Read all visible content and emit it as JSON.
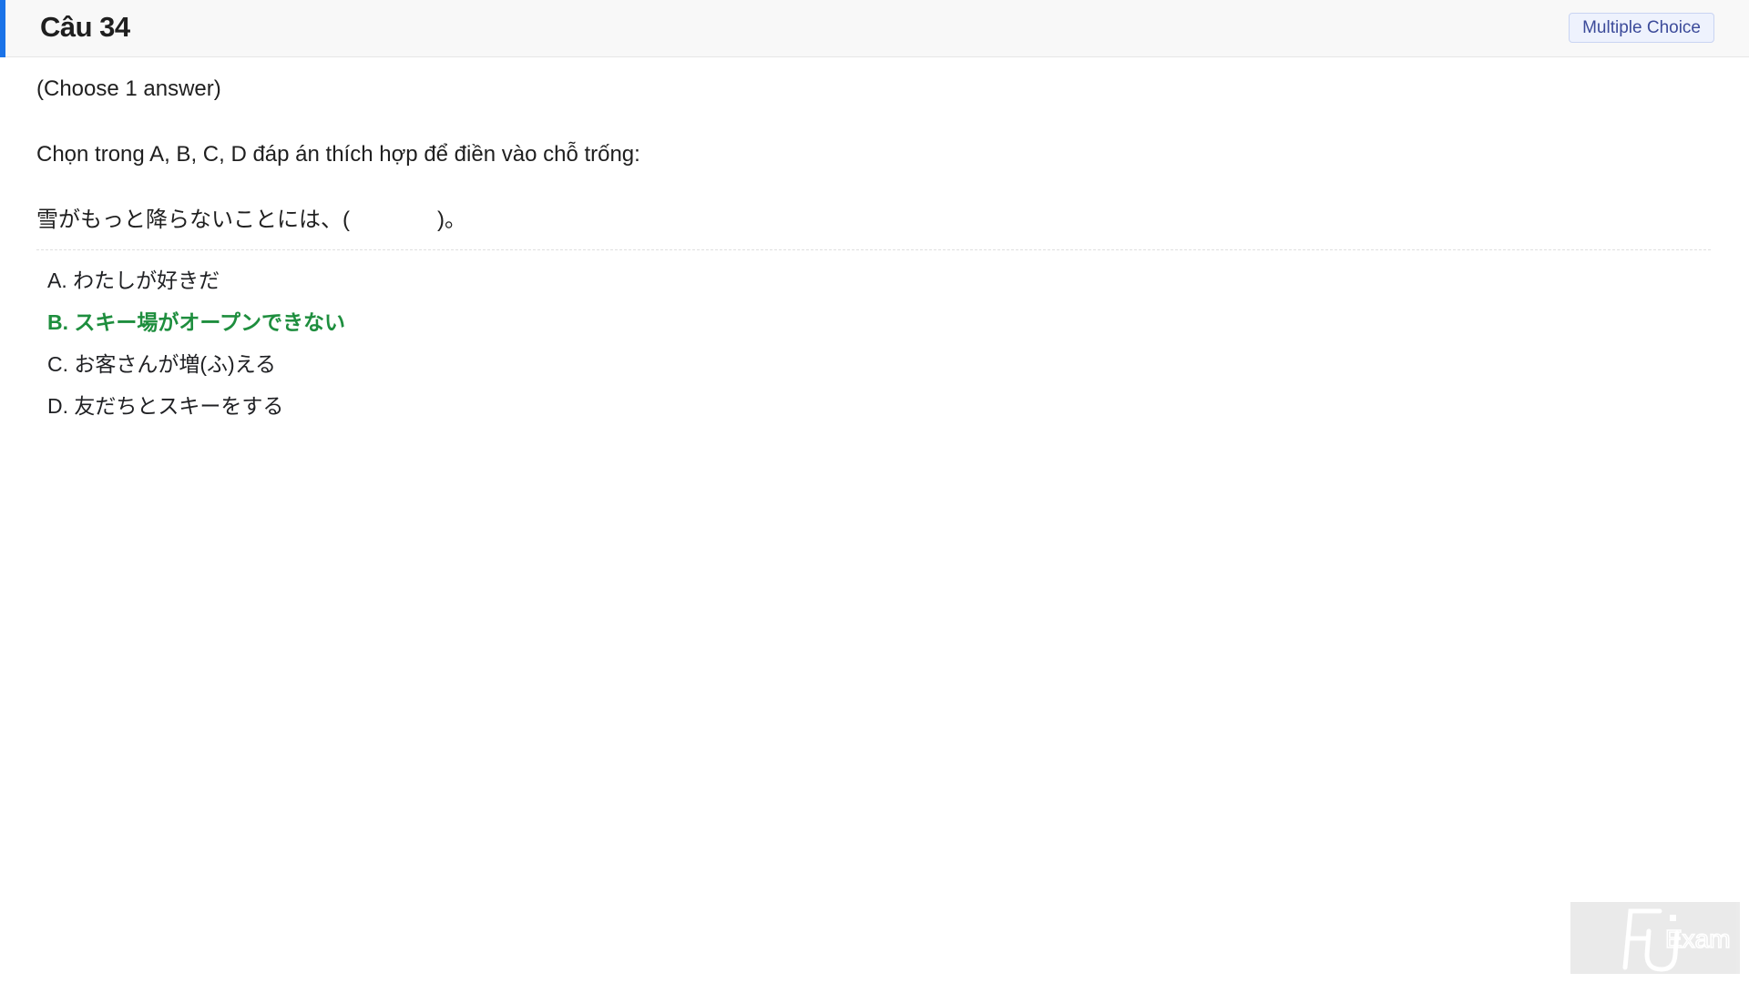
{
  "header": {
    "title": "Câu 34",
    "badge": "Multiple Choice",
    "accent_color": "#1a73e8"
  },
  "question": {
    "instruction": "(Choose 1 answer)",
    "prompt": "Chọn trong A, B, C, D đáp án thích hợp để điền vào chỗ trống:",
    "sentence": "雪がもっと降らないことには、(　　　　)。"
  },
  "options": [
    {
      "label": "A. わたしが好きだ",
      "correct": false
    },
    {
      "label": "B. スキー場がオープンできない",
      "correct": true
    },
    {
      "label": "C. お客さんが増(ふ)える",
      "correct": false
    },
    {
      "label": "D. 友だちとスキーをする",
      "correct": false
    }
  ],
  "colors": {
    "correct": "#1e8e3e",
    "badge_text": "#3c4b9a"
  },
  "watermark": {
    "logo_text": "FU",
    "label": "Exam",
    "icon": "fu-exam-logo-icon"
  }
}
